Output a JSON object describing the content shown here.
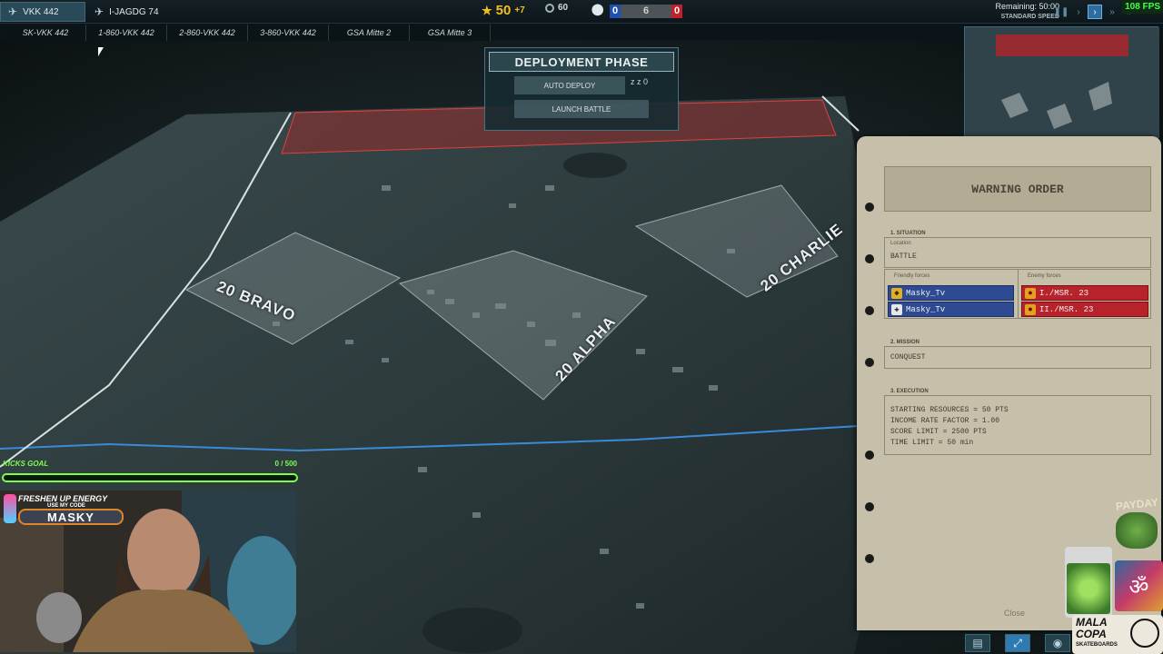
{
  "topbar": {
    "unit_tabs": [
      {
        "label": "VKK 442",
        "active": true
      },
      {
        "label": "I-JAGDG 74",
        "active": false
      }
    ],
    "resources": {
      "points": "50",
      "income": "+7",
      "time_icon_value": "60"
    },
    "score": {
      "blue": "0",
      "middle": "6",
      "red": "0"
    },
    "remaining": "Remaining: 50:00",
    "speed_label": "STANDARD SPEED",
    "fps": "108 FPS"
  },
  "subtabs": [
    "SK-VKK 442",
    "1-860-VKK 442",
    "2-860-VKK 442",
    "3-860-VKK 442",
    "GSA Mitte 2",
    "GSA Mitte 3"
  ],
  "deployment": {
    "title": "DEPLOYMENT PHASE",
    "auto_deploy": "AUTO DEPLOY",
    "launch_battle": "LAUNCH BATTLE",
    "zz": "z z 0"
  },
  "map": {
    "zones": [
      {
        "label": "20 BRAVO"
      },
      {
        "label": "20 ALPHA"
      },
      {
        "label": "20 CHARLIE"
      }
    ]
  },
  "order": {
    "title": "WARNING ORDER",
    "situation_label": "1. SITUATION",
    "location_label": "Location",
    "location": "BATTLE",
    "friendly_label": "Friendly forces",
    "enemy_label": "Enemy forces",
    "friendly": [
      "Masky_Tv",
      "Masky_Tv"
    ],
    "enemy": [
      "I./MSR. 23",
      "II./MSR. 23"
    ],
    "mission_label": "2. MISSION",
    "mission": "CONQUEST",
    "execution_label": "3. EXECUTION",
    "execution": [
      "STARTING RESOURCES = 50 PTS",
      "INCOME RATE FACTOR = 1.00",
      "SCORE LIMIT = 2500 PTS",
      "TIME LIMIT = 50 min"
    ],
    "close": "Close"
  },
  "overlay": {
    "kicks_goal": "KICKS GOAL",
    "kicks_count": "0 / 500",
    "kicks_progress": 0,
    "promo_title": "FRESHEN UP ENERGY",
    "promo_sub": "USE MY CODE",
    "promo_code": "MASKY",
    "sponsor_top": "PAYDAY",
    "sponsor_bottom_1": "MALA",
    "sponsor_bottom_2": "COPA",
    "sponsor_bottom_3": "SKATEBOARDS"
  },
  "colors": {
    "blue_team": "#1f4fb0",
    "red_team": "#c0202a",
    "paper": "#c6bfa9",
    "accent": "#4a7282",
    "kicks_green": "#7dff4a"
  }
}
